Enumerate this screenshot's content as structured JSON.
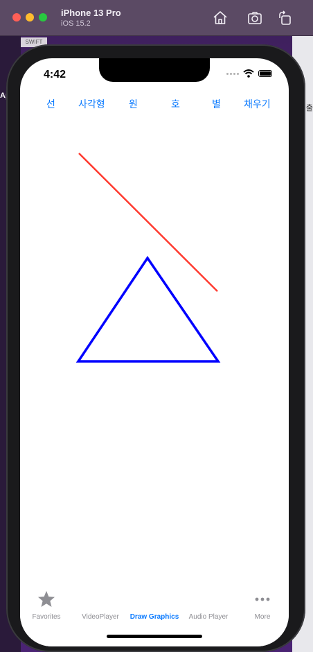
{
  "simulator": {
    "title": "iPhone 13 Pro",
    "subtitle": "iOS 15.2"
  },
  "background": {
    "left_label": "AppD",
    "right_label": "세출",
    "swift_tag": "SWIFT"
  },
  "status_bar": {
    "time": "4:42"
  },
  "toolbar": {
    "buttons": [
      {
        "label": "선"
      },
      {
        "label": "사각형"
      },
      {
        "label": "원"
      },
      {
        "label": "호"
      },
      {
        "label": "별"
      },
      {
        "label": "채우기"
      }
    ]
  },
  "drawing": {
    "line_color": "#ff3b30",
    "triangle_color": "#0000ff"
  },
  "tabbar": {
    "tabs": [
      {
        "label": "Favorites",
        "icon": "star-icon"
      },
      {
        "label": "VideoPlayer",
        "icon": ""
      },
      {
        "label": "Draw Graphics",
        "icon": ""
      },
      {
        "label": "Audio Player",
        "icon": ""
      },
      {
        "label": "More",
        "icon": "more-icon"
      }
    ],
    "active_index": 2,
    "active_color": "#0a7aff",
    "inactive_color": "#8e8e93"
  }
}
